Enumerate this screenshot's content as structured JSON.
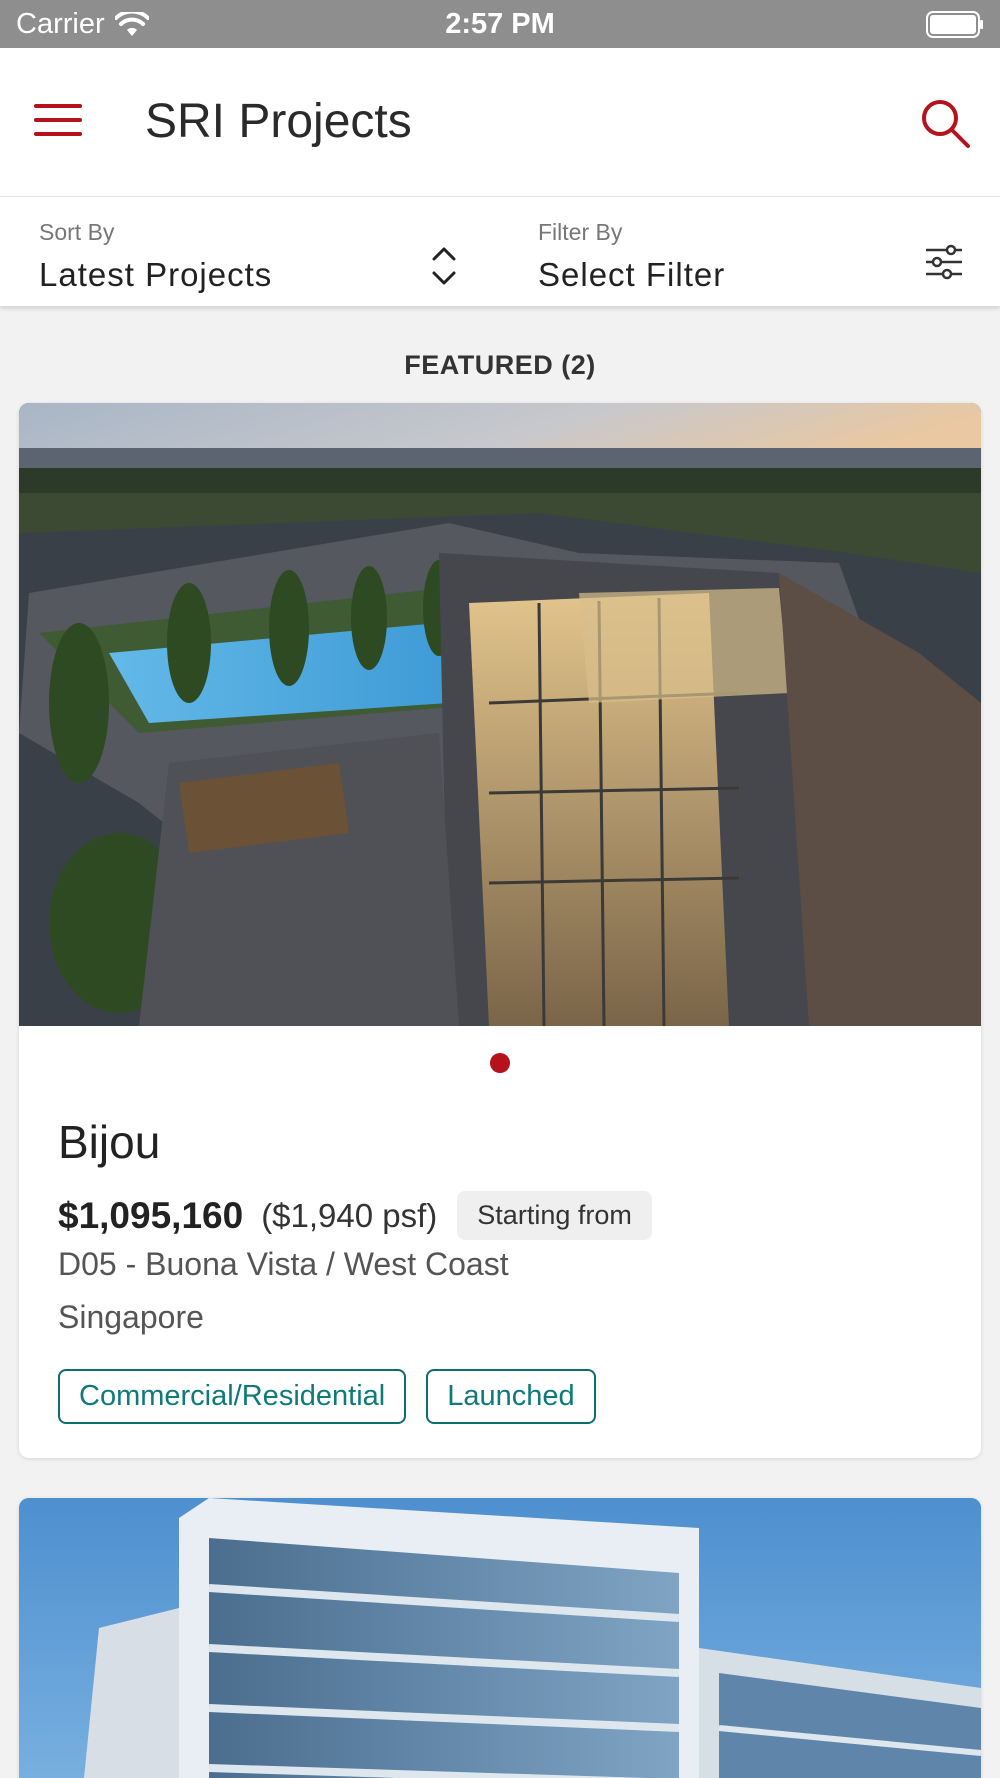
{
  "status_bar": {
    "carrier": "Carrier",
    "time": "2:57 PM"
  },
  "header": {
    "title": "SRI Projects",
    "menu_icon": "hamburger-menu-icon",
    "search_icon": "search-icon",
    "accent_color": "#b5121b"
  },
  "controls": {
    "sort": {
      "caption": "Sort By",
      "value": "Latest Projects",
      "icon": "sort-chevrons-icon"
    },
    "filter": {
      "caption": "Filter By",
      "value": "Select Filter",
      "icon": "sliders-icon"
    }
  },
  "section": {
    "title": "FEATURED (2)"
  },
  "projects": [
    {
      "name": "Bijou",
      "price": "$1,095,160",
      "psf": "($1,940 psf)",
      "price_tag": "Starting from",
      "district": "D05 - Buona Vista / West Coast",
      "country": "Singapore",
      "tags": [
        "Commercial/Residential",
        "Launched"
      ],
      "tag_color": "#0e7a7a",
      "image": "condominium-rooftop-photo"
    },
    {
      "image": "office-building-photo"
    }
  ]
}
